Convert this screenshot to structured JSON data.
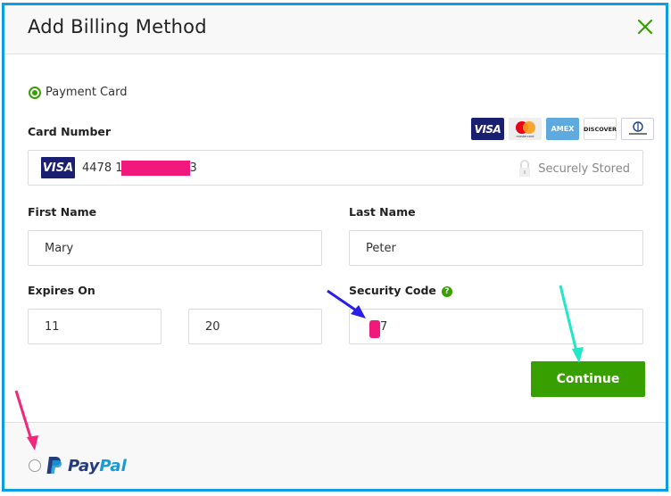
{
  "modal": {
    "title": "Add Billing Method",
    "close_icon": "close-x-icon"
  },
  "payment_card": {
    "option_label": "Payment Card",
    "selected": true,
    "card_number_label": "Card Number",
    "accepted_brands": [
      "VISA",
      "mastercard",
      "AMEX",
      "DISCOVER",
      "Diners Club International"
    ],
    "card_brand": "VISA",
    "card_number_prefix": "4478 1",
    "card_number_suffix": "3",
    "secure_text": "Securely Stored",
    "first_name_label": "First Name",
    "first_name_value": "Mary",
    "last_name_label": "Last Name",
    "last_name_value": "Peter",
    "expires_label": "Expires On",
    "expires_month": "11",
    "expires_year": "20",
    "security_code_label": "Security Code",
    "security_code_help": "?",
    "security_code_visible": "7",
    "continue_label": "Continue"
  },
  "paypal": {
    "selected": false,
    "word_part1": "Pay",
    "word_part2": "Pal"
  },
  "colors": {
    "accent": "#37a000",
    "frame": "#0b9ee3",
    "redaction": "#f2197c",
    "arrow_blue": "#2a1fe6",
    "arrow_teal": "#1ee8c8",
    "arrow_pink": "#f0287c"
  }
}
